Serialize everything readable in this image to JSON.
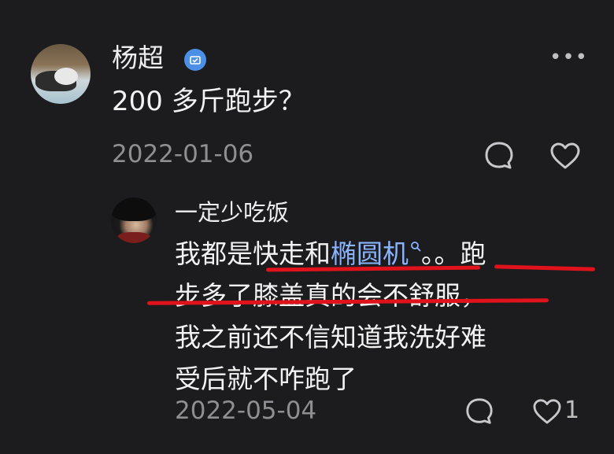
{
  "post": {
    "username": "杨超",
    "text": "200 多斤跑步？",
    "date": "2022-01-06"
  },
  "reply": {
    "username": "一定少吃饭",
    "line1_before": "我都是快走和",
    "line1_link": "椭圆机",
    "line1_after": "。。跑",
    "line2": "步多了膝盖真的会不舒服，",
    "line3": "我之前还不信知道我洗好难",
    "line4": "受后就不咋跑了",
    "date": "2022-05-04",
    "like_count": "1"
  },
  "icons": {
    "verified": "verified-badge-icon",
    "more": "more-icon",
    "comment": "comment-bubble-icon",
    "like": "heart-icon",
    "search_link": "search-link-icon"
  },
  "colors": {
    "background": "#1c1c1e",
    "link": "#8ab4ff",
    "annotation": "#e0121b",
    "muted": "#8e8e93"
  }
}
